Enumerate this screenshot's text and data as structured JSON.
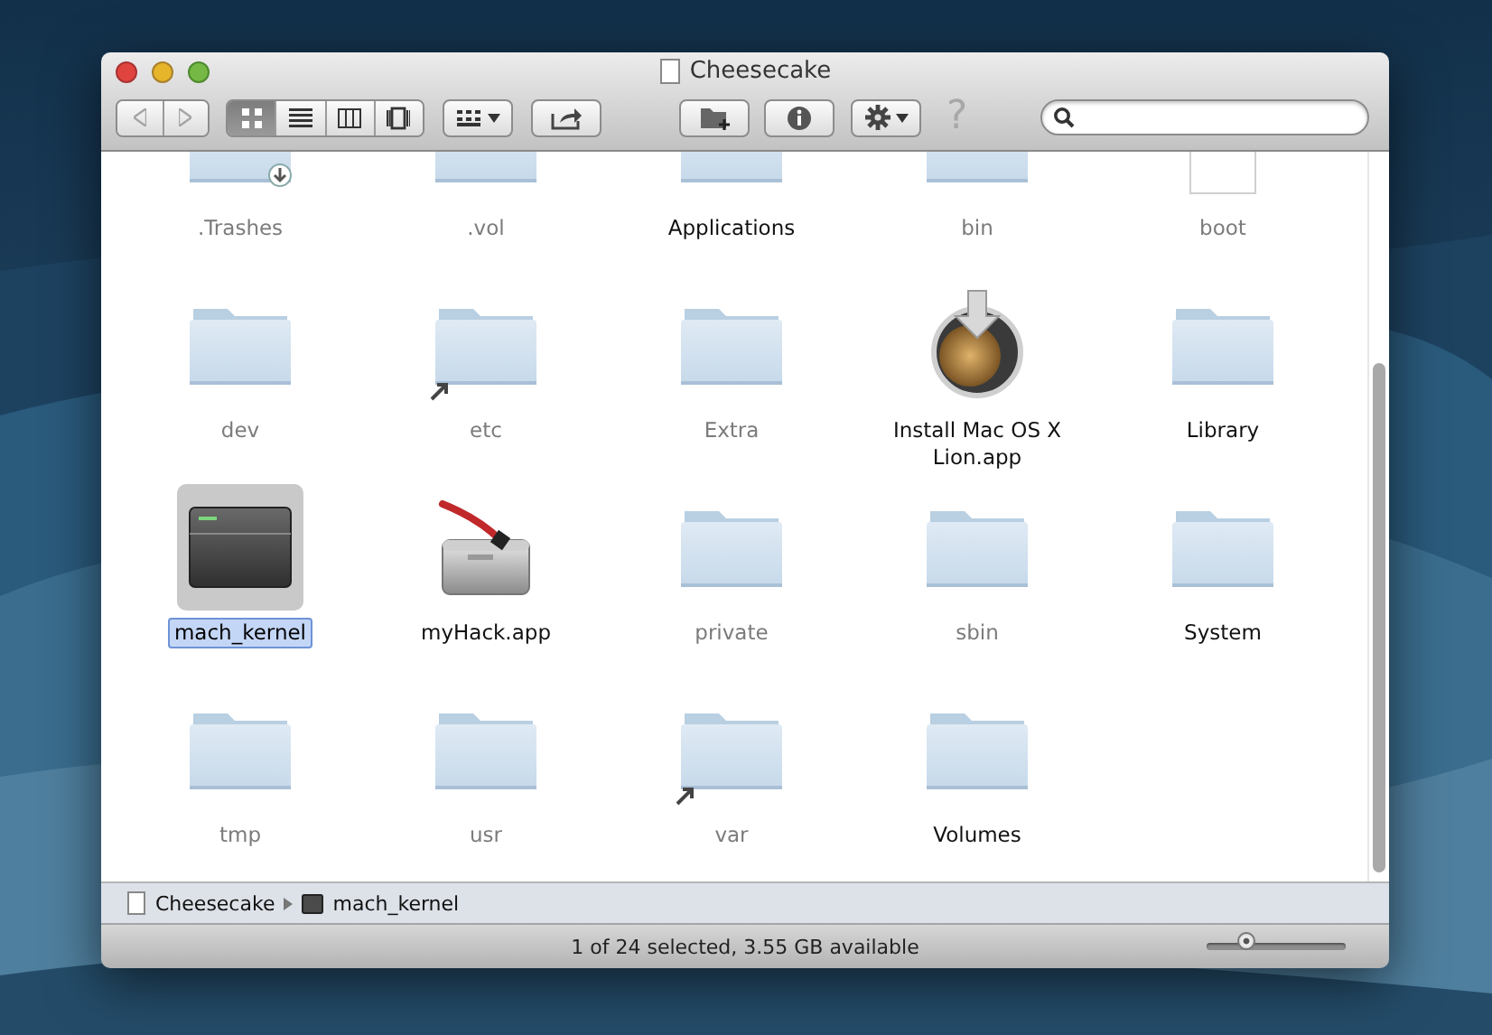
{
  "window": {
    "title": "Cheesecake"
  },
  "toolbar": {
    "nav": [
      {
        "kind": "back",
        "disabled": true
      },
      {
        "kind": "forward",
        "disabled": true
      }
    ],
    "view_modes": [
      {
        "kind": "icon",
        "selected": true
      },
      {
        "kind": "list",
        "selected": false
      },
      {
        "kind": "columns",
        "selected": false
      },
      {
        "kind": "coverflow",
        "selected": false
      }
    ],
    "help": "?"
  },
  "items": [
    {
      "name": ".Trashes",
      "kind": "drop_folder",
      "hidden": true,
      "alias": false,
      "selected": false
    },
    {
      "name": ".vol",
      "kind": "folder",
      "hidden": true,
      "alias": false,
      "selected": false
    },
    {
      "name": "Applications",
      "kind": "folder",
      "hidden": false,
      "alias": false,
      "selected": false
    },
    {
      "name": "bin",
      "kind": "folder",
      "hidden": true,
      "alias": false,
      "selected": false
    },
    {
      "name": "boot",
      "kind": "document",
      "hidden": true,
      "alias": false,
      "selected": false
    },
    {
      "name": "dev",
      "kind": "folder",
      "hidden": true,
      "alias": false,
      "selected": false
    },
    {
      "name": "etc",
      "kind": "folder",
      "hidden": true,
      "alias": true,
      "selected": false
    },
    {
      "name": "Extra",
      "kind": "folder",
      "hidden": true,
      "alias": false,
      "selected": false
    },
    {
      "name": "Install Mac OS X Lion.app",
      "kind": "installer",
      "hidden": false,
      "alias": false,
      "selected": false
    },
    {
      "name": "Library",
      "kind": "folder",
      "hidden": false,
      "alias": false,
      "selected": false
    },
    {
      "name": "mach_kernel",
      "kind": "kernel",
      "hidden": false,
      "alias": false,
      "selected": true
    },
    {
      "name": "myHack.app",
      "kind": "app",
      "hidden": false,
      "alias": false,
      "selected": false
    },
    {
      "name": "private",
      "kind": "folder",
      "hidden": true,
      "alias": false,
      "selected": false
    },
    {
      "name": "sbin",
      "kind": "folder",
      "hidden": true,
      "alias": false,
      "selected": false
    },
    {
      "name": "System",
      "kind": "folder",
      "hidden": false,
      "alias": false,
      "selected": false
    },
    {
      "name": "tmp",
      "kind": "folder",
      "hidden": true,
      "alias": false,
      "selected": false
    },
    {
      "name": "usr",
      "kind": "folder",
      "hidden": true,
      "alias": false,
      "selected": false
    },
    {
      "name": "var",
      "kind": "folder",
      "hidden": true,
      "alias": true,
      "selected": false
    },
    {
      "name": "Volumes",
      "kind": "folder",
      "hidden": false,
      "alias": false,
      "selected": false
    }
  ],
  "path_bar": [
    {
      "label": "Cheesecake",
      "kind": "disk"
    },
    {
      "label": "mach_kernel",
      "kind": "kernel"
    }
  ],
  "status_bar": {
    "text": "1 of 24 selected, 3.55 GB available",
    "icon_size": {
      "level": 0.25
    }
  }
}
